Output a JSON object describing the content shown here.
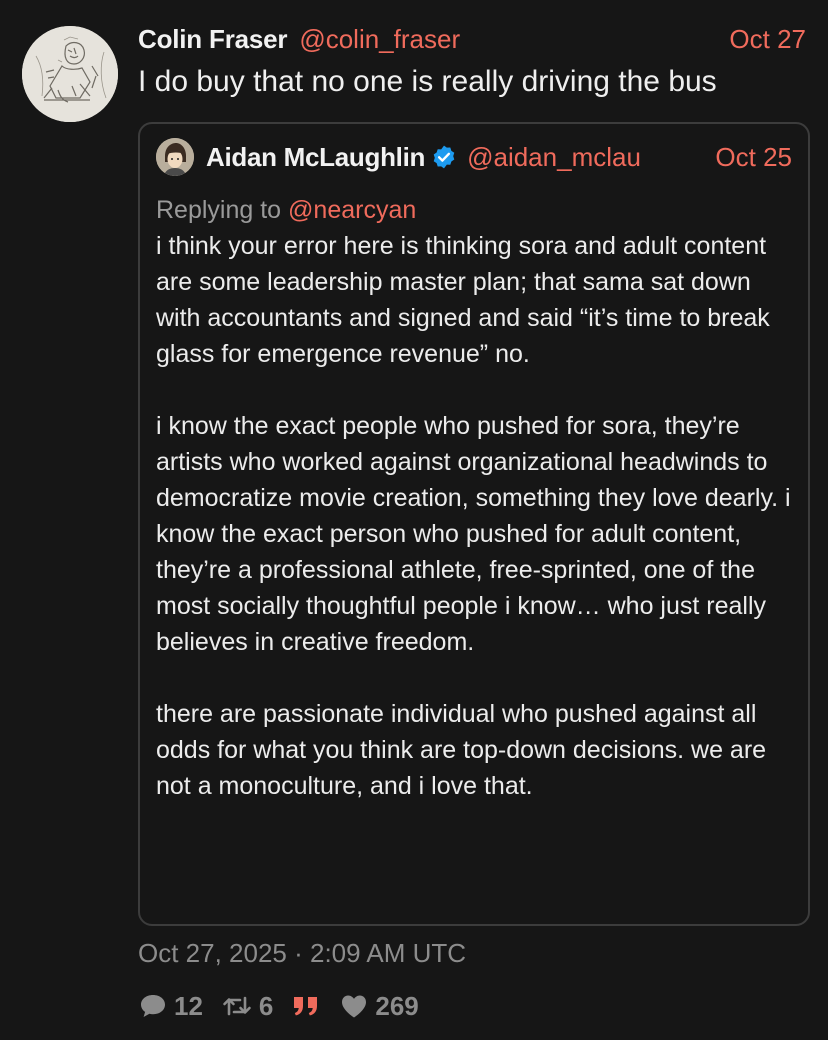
{
  "tweet": {
    "author_name": "Colin Fraser",
    "author_handle": "@colin_fraser",
    "date": "Oct 27",
    "text": "I do buy that no one is really driving the bus",
    "timestamp": "Oct 27, 2025 · 2:09 AM UTC"
  },
  "quoted": {
    "author_name": "Aidan McLaughlin",
    "author_handle": "@aidan_mclau",
    "date": "Oct 25",
    "verified": true,
    "replying_prefix": "Replying to ",
    "replying_handle": "@nearcyan",
    "paragraphs": [
      "i think your error here is thinking sora and adult content are some leadership master plan; that sama sat down with accountants and signed and said “it’s time to break glass for emergence revenue” no.",
      "i know the exact people who pushed for sora, they’re artists who worked against organizational headwinds to democratize movie creation, something they love dearly. i know the exact person who pushed for adult content, they’re a professional athlete, free-sprinted, one of the most socially thoughtful people i know… who just really believes in creative freedom.",
      "there are passionate individual who pushed against all odds for what you think are top-down decisions. we are not a monoculture, and i love that."
    ]
  },
  "stats": {
    "replies": "12",
    "retweets": "6",
    "likes": "269"
  },
  "colors": {
    "accent": "#f06b5c",
    "background": "#161616",
    "muted": "#8c8c8c",
    "verified": "#1d9bf0"
  },
  "icons": {
    "reply": "comment-icon",
    "retweet": "retweet-icon",
    "quote": "quote-icon",
    "like": "heart-icon",
    "verified": "verified-badge-icon"
  }
}
